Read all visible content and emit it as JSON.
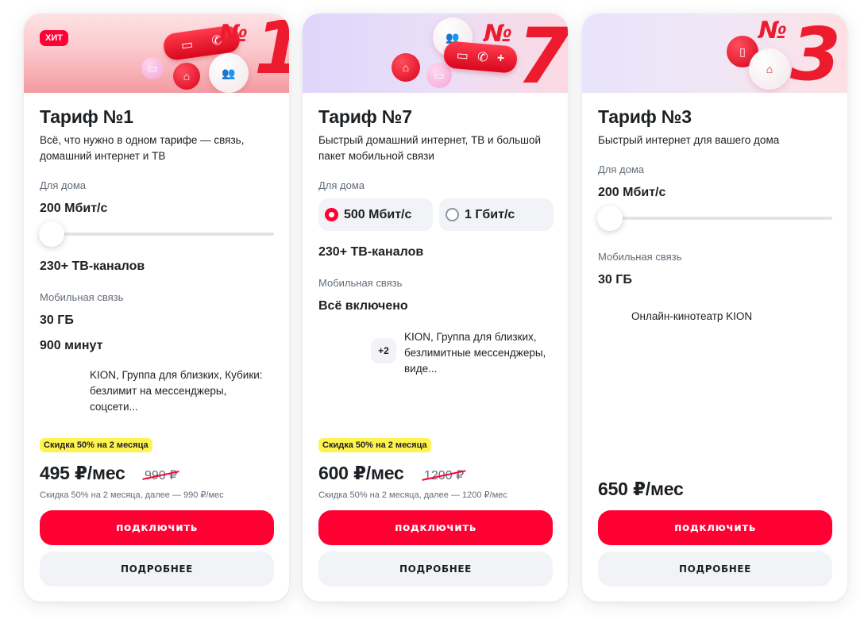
{
  "tariffs": [
    {
      "badge": "ХИТ",
      "banner_number": "1",
      "banner_sign": "№",
      "title": "Тариф №1",
      "description": "Всё, что нужно в одном тарифе — связь, домашний интернет и ТВ",
      "home_label": "Для дома",
      "speed": "200 Мбит/с",
      "slider_level": 0,
      "tv": "230+ ТВ-каналов",
      "mobile_label": "Мобильная связь",
      "data": "30 ГБ",
      "minutes": "900 минут",
      "extras": "KION, Группа для близких, Кубики: безлимит на мессенджеры, соцсети...",
      "discount_badge": "Скидка 50% на 2 месяца",
      "price": "495 ₽/мес",
      "old_price": "990 ₽",
      "price_note": "Скидка 50% на 2 месяца, далее — 990 ₽/мес",
      "connect_label": "подключить",
      "details_label": "ПОДРОБНЕЕ"
    },
    {
      "banner_number": "7",
      "banner_sign": "№",
      "title": "Тариф №7",
      "description": "Быстрый домашний интернет, ТВ и большой пакет мобильной связи",
      "home_label": "Для дома",
      "speed_options": [
        {
          "label": "500 Мбит/с",
          "selected": true
        },
        {
          "label": "1 Гбит/с",
          "selected": false
        }
      ],
      "tv": "230+ ТВ-каналов",
      "mobile_label": "Мобильная связь",
      "mobile_value": "Всё включено",
      "extras_count": "+2",
      "extras": "KION, Группа для близких, безлимитные мессенджеры, виде...",
      "discount_badge": "Скидка 50% на 2 месяца",
      "price": "600 ₽/мес",
      "old_price": "1200 ₽",
      "price_note": "Скидка 50% на 2 месяца, далее — 1200 ₽/мес",
      "connect_label": "подключить",
      "details_label": "ПОДРОБНЕЕ"
    },
    {
      "banner_number": "3",
      "banner_sign": "№",
      "title": "Тариф №3",
      "description": "Быстрый интернет для вашего дома",
      "home_label": "Для дома",
      "speed": "200 Мбит/с",
      "slider_level": 0,
      "mobile_label": "Мобильная связь",
      "data": "30 ГБ",
      "extras": "Онлайн-кинотеатр KION",
      "price": "650 ₽/мес",
      "connect_label": "подключить",
      "details_label": "ПОДРОБНЕЕ"
    }
  ],
  "colors": {
    "accent": "#ff0032",
    "discount": "#fff34f",
    "secondary_button": "#f2f3f7"
  },
  "icons": [
    "chat-icon",
    "phone-icon",
    "plus-icon",
    "group-icon",
    "tv-icon",
    "home-wifi-icon",
    "sim-icon"
  ]
}
